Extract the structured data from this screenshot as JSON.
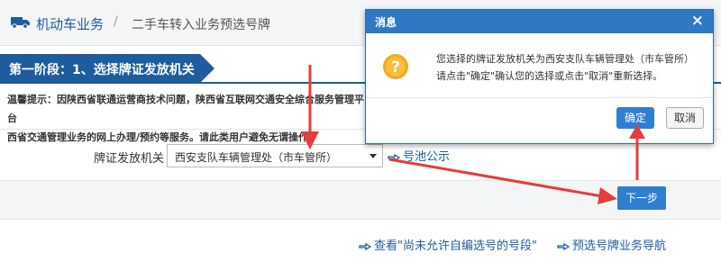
{
  "breadcrumb": {
    "home_label": "机动车业务",
    "separator": "/",
    "current_label": "二手车转入业务预选号牌"
  },
  "stage": {
    "label": "第一阶段：1、选择牌证发放机关"
  },
  "notice": {
    "line1": "温馨提示：因陕西省联通运营商技术问题，陕西省互联网交通安全综合服务管理平台",
    "line2": "西省交通管理业务的网上办理/预约等服务。请此类用户避免无谓操作！"
  },
  "form": {
    "field_label": "牌证发放机关",
    "select_value": "西安支队车辆管理处（市车管所）",
    "pool_link": "号池公示"
  },
  "next_button": "下一步",
  "bottom_links": {
    "view_unallowed": "查看\"尚未允许自编选号的号段\"",
    "guide": "预选号牌业务导航"
  },
  "dialog": {
    "title": "消息",
    "close": "×",
    "message_line1": "您选择的牌证发放机关为西安支队车辆管理处（市车管所）",
    "message_line2": "请点击\"确定\"确认您的选择或点击\"取消\"重新选择。",
    "ok_label": "确定",
    "cancel_label": "取消"
  },
  "colors": {
    "brand_blue": "#1e5c9e",
    "button_blue": "#2f7fd0",
    "arrow_red": "#e53c3c"
  }
}
